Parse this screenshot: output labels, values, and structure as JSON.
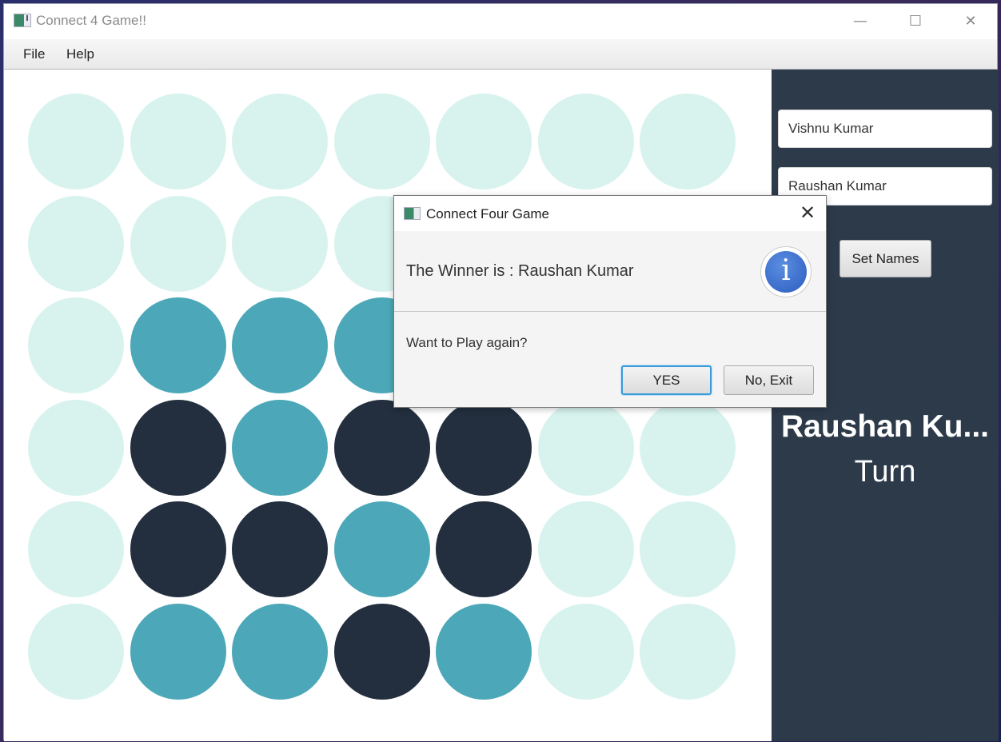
{
  "window": {
    "title": "Connect 4 Game!!",
    "controls": {
      "minimize": "—",
      "maximize": "☐",
      "close": "✕"
    }
  },
  "menu": {
    "items": [
      "File",
      "Help"
    ]
  },
  "colors": {
    "empty": "#d8f3ee",
    "player1": "#232f3e",
    "player2": "#4ca8b8",
    "sidebar": "#2d3a4a"
  },
  "board": {
    "rows": 6,
    "cols": 7,
    "cells": [
      [
        "E",
        "E",
        "E",
        "E",
        "E",
        "E",
        "E"
      ],
      [
        "E",
        "E",
        "E",
        "E",
        "E",
        "E",
        "E"
      ],
      [
        "E",
        "P2",
        "P2",
        "P2",
        "E",
        "E",
        "E"
      ],
      [
        "E",
        "P1",
        "P2",
        "P1",
        "P1",
        "E",
        "E"
      ],
      [
        "E",
        "P1",
        "P1",
        "P2",
        "P1",
        "E",
        "E"
      ],
      [
        "E",
        "P2",
        "P2",
        "P1",
        "P2",
        "E",
        "E"
      ]
    ]
  },
  "sidebar": {
    "player1_name": "Vishnu Kumar",
    "player2_name": "Raushan Kumar",
    "set_names_label": "Set Names",
    "current_player": "Raushan Ku...",
    "turn_label": "Turn"
  },
  "dialog": {
    "title": "Connect Four Game",
    "close": "✕",
    "header": "The Winner is : Raushan Kumar",
    "icon": "info-icon",
    "content": "Want to Play again?",
    "yes_label": "YES",
    "no_label": "No, Exit"
  }
}
